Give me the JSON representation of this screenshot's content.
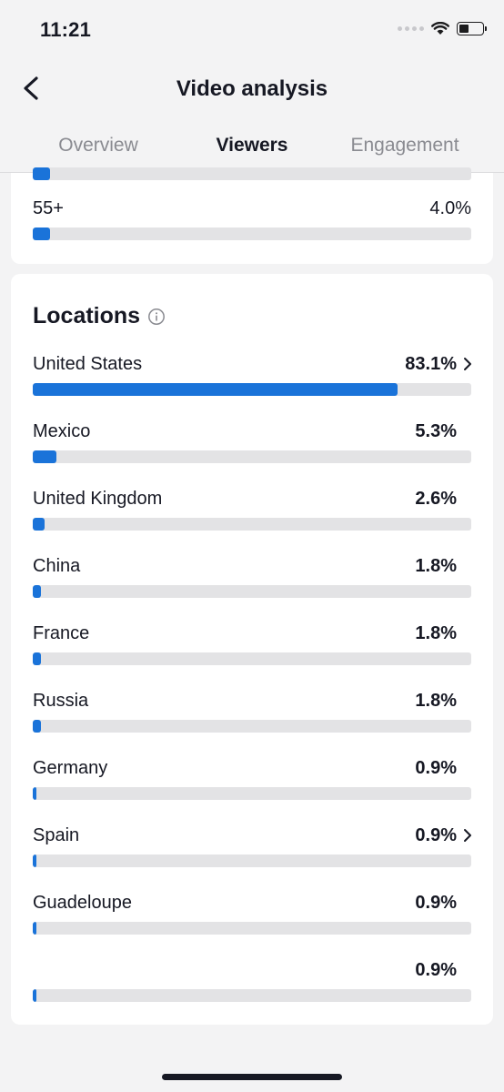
{
  "status": {
    "time": "11:21"
  },
  "nav": {
    "title": "Video analysis"
  },
  "tabs": [
    {
      "label": "Overview",
      "active": false
    },
    {
      "label": "Viewers",
      "active": true
    },
    {
      "label": "Engagement",
      "active": false
    }
  ],
  "age": {
    "rows": [
      {
        "label": "55+",
        "value": "4.0%",
        "percent": 4.0
      }
    ]
  },
  "locations": {
    "title": "Locations",
    "rows": [
      {
        "label": "United States",
        "value": "83.1%",
        "percent": 83.1,
        "chevron": true
      },
      {
        "label": "Mexico",
        "value": "5.3%",
        "percent": 5.3,
        "chevron": false
      },
      {
        "label": "United Kingdom",
        "value": "2.6%",
        "percent": 2.6,
        "chevron": false
      },
      {
        "label": "China",
        "value": "1.8%",
        "percent": 1.8,
        "chevron": false
      },
      {
        "label": "France",
        "value": "1.8%",
        "percent": 1.8,
        "chevron": false
      },
      {
        "label": "Russia",
        "value": "1.8%",
        "percent": 1.8,
        "chevron": false
      },
      {
        "label": "Germany",
        "value": "0.9%",
        "percent": 0.9,
        "chevron": false
      },
      {
        "label": "Spain",
        "value": "0.9%",
        "percent": 0.9,
        "chevron": true
      },
      {
        "label": "Guadeloupe",
        "value": "0.9%",
        "percent": 0.9,
        "chevron": false
      },
      {
        "label": "",
        "value": "0.9%",
        "percent": 0.9,
        "chevron": false
      }
    ]
  },
  "colors": {
    "bar": "#1a73d9",
    "track": "#e3e3e5"
  }
}
